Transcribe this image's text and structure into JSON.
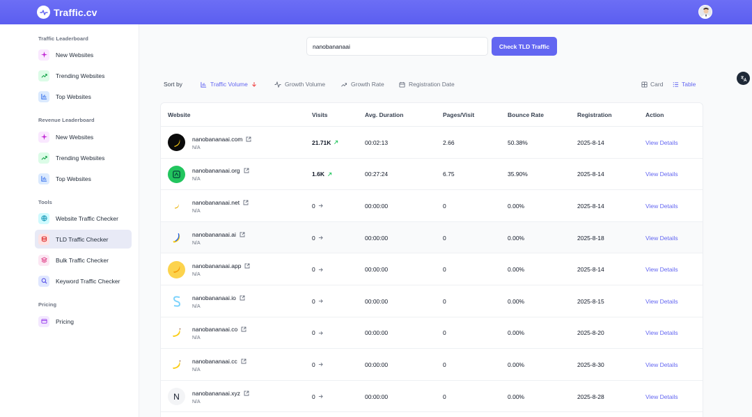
{
  "app": {
    "title": "Traffic.cv"
  },
  "sidebar": {
    "sections": [
      {
        "title": "Traffic Leaderboard",
        "items": [
          {
            "label": "New Websites",
            "icon": "sparkle-icon"
          },
          {
            "label": "Trending Websites",
            "icon": "trending-up-icon"
          },
          {
            "label": "Top Websites",
            "icon": "bar-chart-icon"
          }
        ]
      },
      {
        "title": "Revenue Leaderboard",
        "items": [
          {
            "label": "New Websites",
            "icon": "sparkle-icon"
          },
          {
            "label": "Trending Websites",
            "icon": "trending-up-icon"
          },
          {
            "label": "Top Websites",
            "icon": "bar-chart-icon"
          }
        ]
      },
      {
        "title": "Tools",
        "items": [
          {
            "label": "Website Traffic Checker",
            "icon": "globe-icon"
          },
          {
            "label": "TLD Traffic Checker",
            "icon": "database-icon",
            "active": true
          },
          {
            "label": "Bulk Traffic Checker",
            "icon": "bulk-icon"
          },
          {
            "label": "Keyword Traffic Checker",
            "icon": "search-icon"
          }
        ]
      },
      {
        "title": "Pricing",
        "items": [
          {
            "label": "Pricing",
            "icon": "credit-card-icon"
          }
        ]
      }
    ]
  },
  "search": {
    "value": "nanobananaai",
    "button_label": "Check TLD Traffic"
  },
  "sort": {
    "label": "Sort by",
    "options": [
      {
        "label": "Traffic Volume",
        "active": true
      },
      {
        "label": "Growth Volume"
      },
      {
        "label": "Growth Rate"
      },
      {
        "label": "Registration Date"
      }
    ]
  },
  "view": {
    "card_label": "Card",
    "table_label": "Table",
    "active": "Table"
  },
  "table": {
    "columns": [
      "Website",
      "Visits",
      "Avg. Duration",
      "Pages/Visit",
      "Bounce Rate",
      "Registration",
      "Action"
    ],
    "rows": [
      {
        "site": "nanobananaai.com",
        "sub": "N/A",
        "visits": "21.71K",
        "trend": "up",
        "duration": "00:02:13",
        "pages": "2.66",
        "bounce": "50.38%",
        "registration": "2025-8-14",
        "action": "View Details",
        "logo": "banana-dark"
      },
      {
        "site": "nanobananaai.org",
        "sub": "N/A",
        "visits": "1.6K",
        "trend": "up",
        "duration": "00:27:24",
        "pages": "6.75",
        "bounce": "35.90%",
        "registration": "2025-8-14",
        "action": "View Details",
        "logo": "green"
      },
      {
        "site": "nanobananaai.net",
        "sub": "N/A",
        "visits": "0",
        "trend": "flat",
        "duration": "00:00:00",
        "pages": "0",
        "bounce": "0.00%",
        "registration": "2025-8-14",
        "action": "View Details",
        "logo": "banana-small"
      },
      {
        "site": "nanobananaai.ai",
        "sub": "N/A",
        "visits": "0",
        "trend": "flat",
        "duration": "00:00:00",
        "pages": "0",
        "bounce": "0.00%",
        "registration": "2025-8-18",
        "action": "View Details",
        "logo": "banana-blue"
      },
      {
        "site": "nanobananaai.app",
        "sub": "N/A",
        "visits": "0",
        "trend": "flat",
        "duration": "00:00:00",
        "pages": "0",
        "bounce": "0.00%",
        "registration": "2025-8-14",
        "action": "View Details",
        "logo": "banana-yellow"
      },
      {
        "site": "nanobananaai.io",
        "sub": "N/A",
        "visits": "0",
        "trend": "flat",
        "duration": "00:00:00",
        "pages": "0",
        "bounce": "0.00%",
        "registration": "2025-8-15",
        "action": "View Details",
        "logo": "s-blue"
      },
      {
        "site": "nanobananaai.co",
        "sub": "N/A",
        "visits": "0",
        "trend": "flat",
        "duration": "00:00:00",
        "pages": "0",
        "bounce": "0.00%",
        "registration": "2025-8-20",
        "action": "View Details",
        "logo": "banana"
      },
      {
        "site": "nanobananaai.cc",
        "sub": "N/A",
        "visits": "0",
        "trend": "flat",
        "duration": "00:00:00",
        "pages": "0",
        "bounce": "0.00%",
        "registration": "2025-8-30",
        "action": "View Details",
        "logo": "banana"
      },
      {
        "site": "nanobananaai.xyz",
        "sub": "N/A",
        "visits": "0",
        "trend": "flat",
        "duration": "00:00:00",
        "pages": "0",
        "bounce": "0.00%",
        "registration": "2025-8-28",
        "action": "View Details",
        "logo": "letter-n",
        "logo_text": "N"
      }
    ]
  },
  "colors": {
    "brand": "#6366f1",
    "trend_up": "#22c55e"
  }
}
